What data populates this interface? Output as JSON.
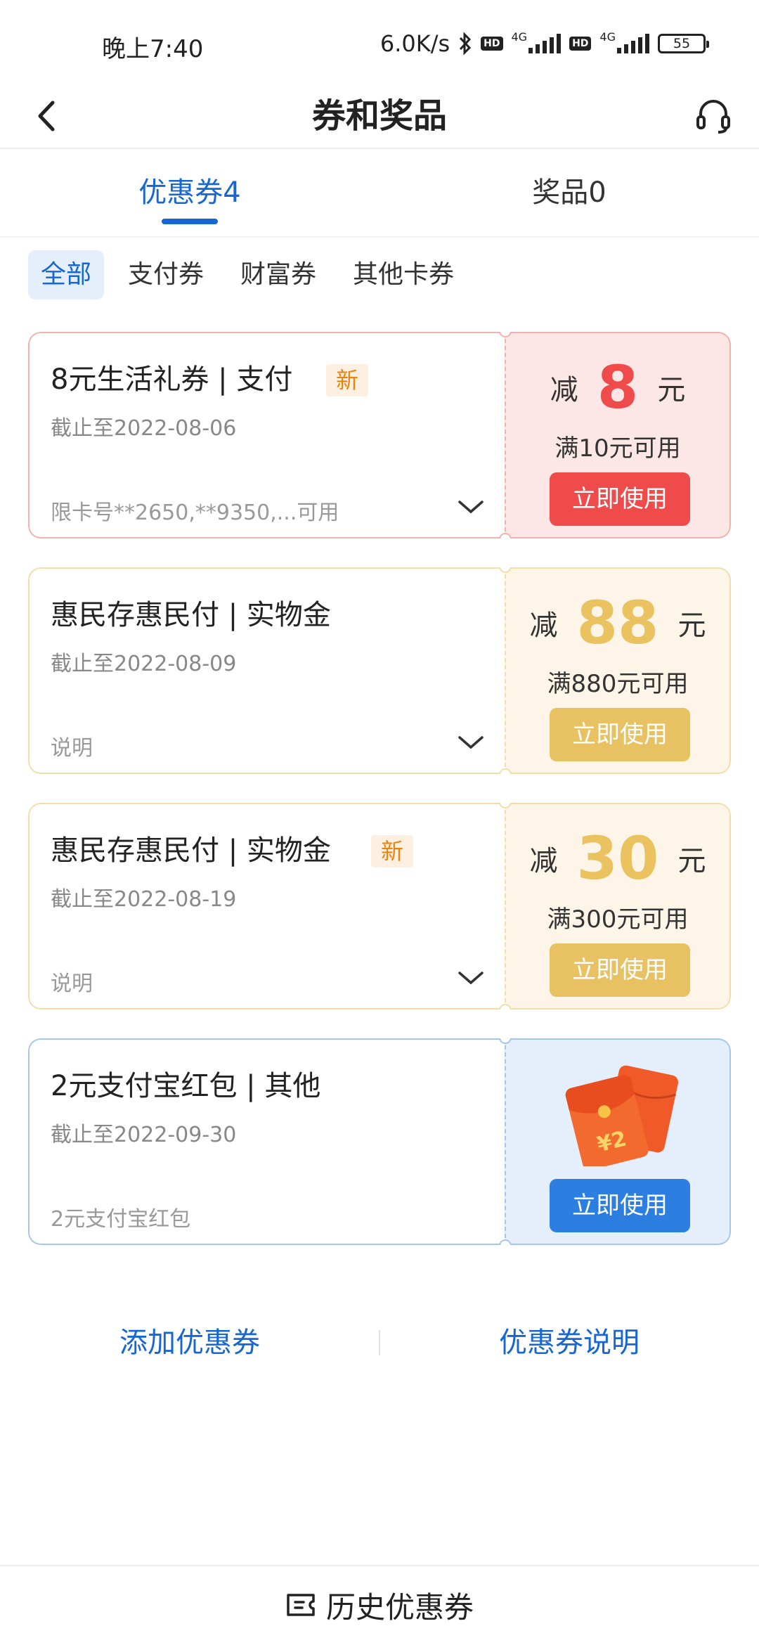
{
  "status_bar": {
    "time": "晚上7:40",
    "speed": "6.0K/s",
    "hd": "HD",
    "network": "4G",
    "battery": "55"
  },
  "header": {
    "title": "券和奖品",
    "back_icon": "chevron-left-icon",
    "service_icon": "headset-icon"
  },
  "tabs": [
    {
      "label": "优惠券4",
      "active": true
    },
    {
      "label": "奖品0",
      "active": false
    }
  ],
  "filters": [
    {
      "label": "全部",
      "active": true
    },
    {
      "label": "支付券",
      "active": false
    },
    {
      "label": "财富券",
      "active": false
    },
    {
      "label": "其他卡券",
      "active": false
    }
  ],
  "coupons": [
    {
      "title": "8元生活礼券 | 支付",
      "badge": "新",
      "expiry": "截止至2022-08-06",
      "note": "限卡号**2650,**9350,...可用",
      "prefix": "减",
      "amount": "8",
      "unit": "元",
      "condition": "满10元可用",
      "button": "立即使用",
      "theme": "red"
    },
    {
      "title": "惠民存惠民付 | 实物金",
      "expiry": "截止至2022-08-09",
      "note": "说明",
      "prefix": "减",
      "amount": "88",
      "unit": "元",
      "condition": "满880元可用",
      "button": "立即使用",
      "theme": "gold"
    },
    {
      "title": "惠民存惠民付 | 实物金",
      "badge": "新",
      "expiry": "截止至2022-08-19",
      "note": "说明",
      "prefix": "减",
      "amount": "30",
      "unit": "元",
      "condition": "满300元可用",
      "button": "立即使用",
      "theme": "gold"
    },
    {
      "title": "2元支付宝红包 | 其他",
      "expiry": "截止至2022-09-30",
      "note": "2元支付宝红包",
      "envelope_text": "¥2",
      "button": "立即使用",
      "theme": "blue"
    }
  ],
  "links": {
    "add": "添加优惠券",
    "explain": "优惠券说明"
  },
  "footer": {
    "history": "历史优惠券"
  },
  "colors": {
    "primary": "#1767d2",
    "red": "#f04b4b",
    "gold": "#e8c262",
    "blue_button": "#2c7fe0"
  }
}
